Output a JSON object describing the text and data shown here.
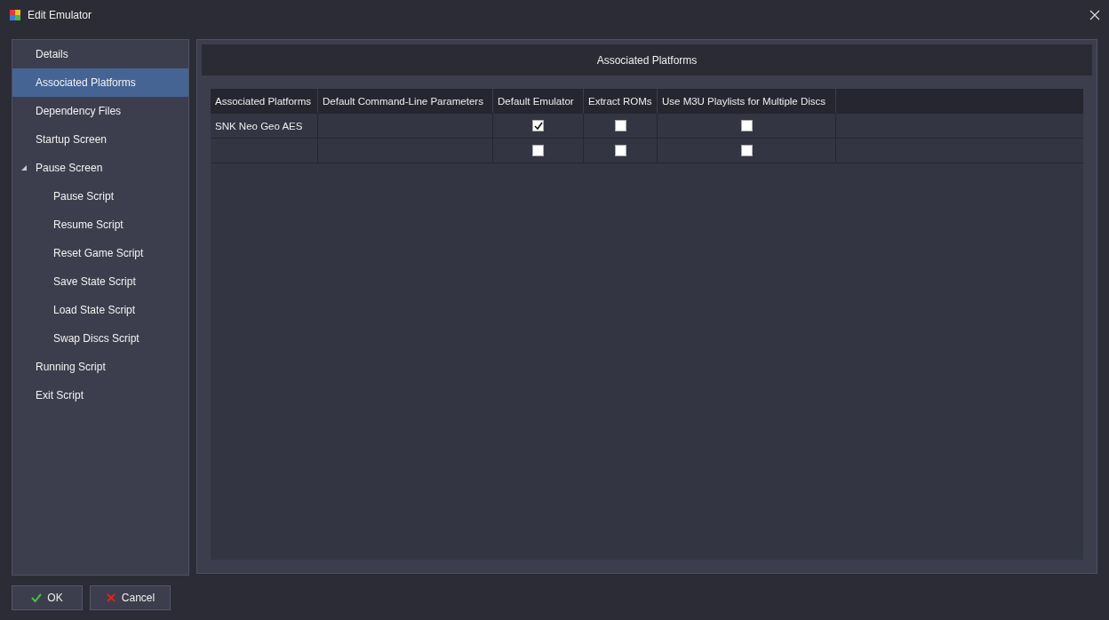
{
  "window": {
    "title": "Edit Emulator"
  },
  "sidebar": {
    "items": [
      {
        "label": "Details",
        "selected": false
      },
      {
        "label": "Associated Platforms",
        "selected": true
      },
      {
        "label": "Dependency Files",
        "selected": false
      },
      {
        "label": "Startup Screen",
        "selected": false
      },
      {
        "label": "Pause Screen",
        "selected": false,
        "expanded": true,
        "children": [
          {
            "label": "Pause Script",
            "selected": false
          },
          {
            "label": "Resume Script",
            "selected": false
          },
          {
            "label": "Reset Game Script",
            "selected": false
          },
          {
            "label": "Save State Script",
            "selected": false
          },
          {
            "label": "Load State Script",
            "selected": false
          },
          {
            "label": "Swap Discs Script",
            "selected": false
          }
        ]
      },
      {
        "label": "Running Script",
        "selected": false
      },
      {
        "label": "Exit Script",
        "selected": false
      }
    ]
  },
  "panel": {
    "title": "Associated Platforms"
  },
  "table": {
    "columns": [
      "Associated Platforms",
      "Default Command-Line Parameters",
      "Default Emulator",
      "Extract ROMs",
      "Use M3U Playlists for Multiple Discs"
    ],
    "rows": [
      {
        "platform": "SNK Neo Geo AES",
        "default_emulator": true,
        "extract_roms": false,
        "use_m3u": false
      },
      {
        "default_emulator": false,
        "extract_roms": false,
        "use_m3u": false
      }
    ]
  },
  "buttons": [
    {
      "kind": "ok",
      "label": "OK"
    },
    {
      "kind": "cancel",
      "label": "Cancel"
    }
  ]
}
